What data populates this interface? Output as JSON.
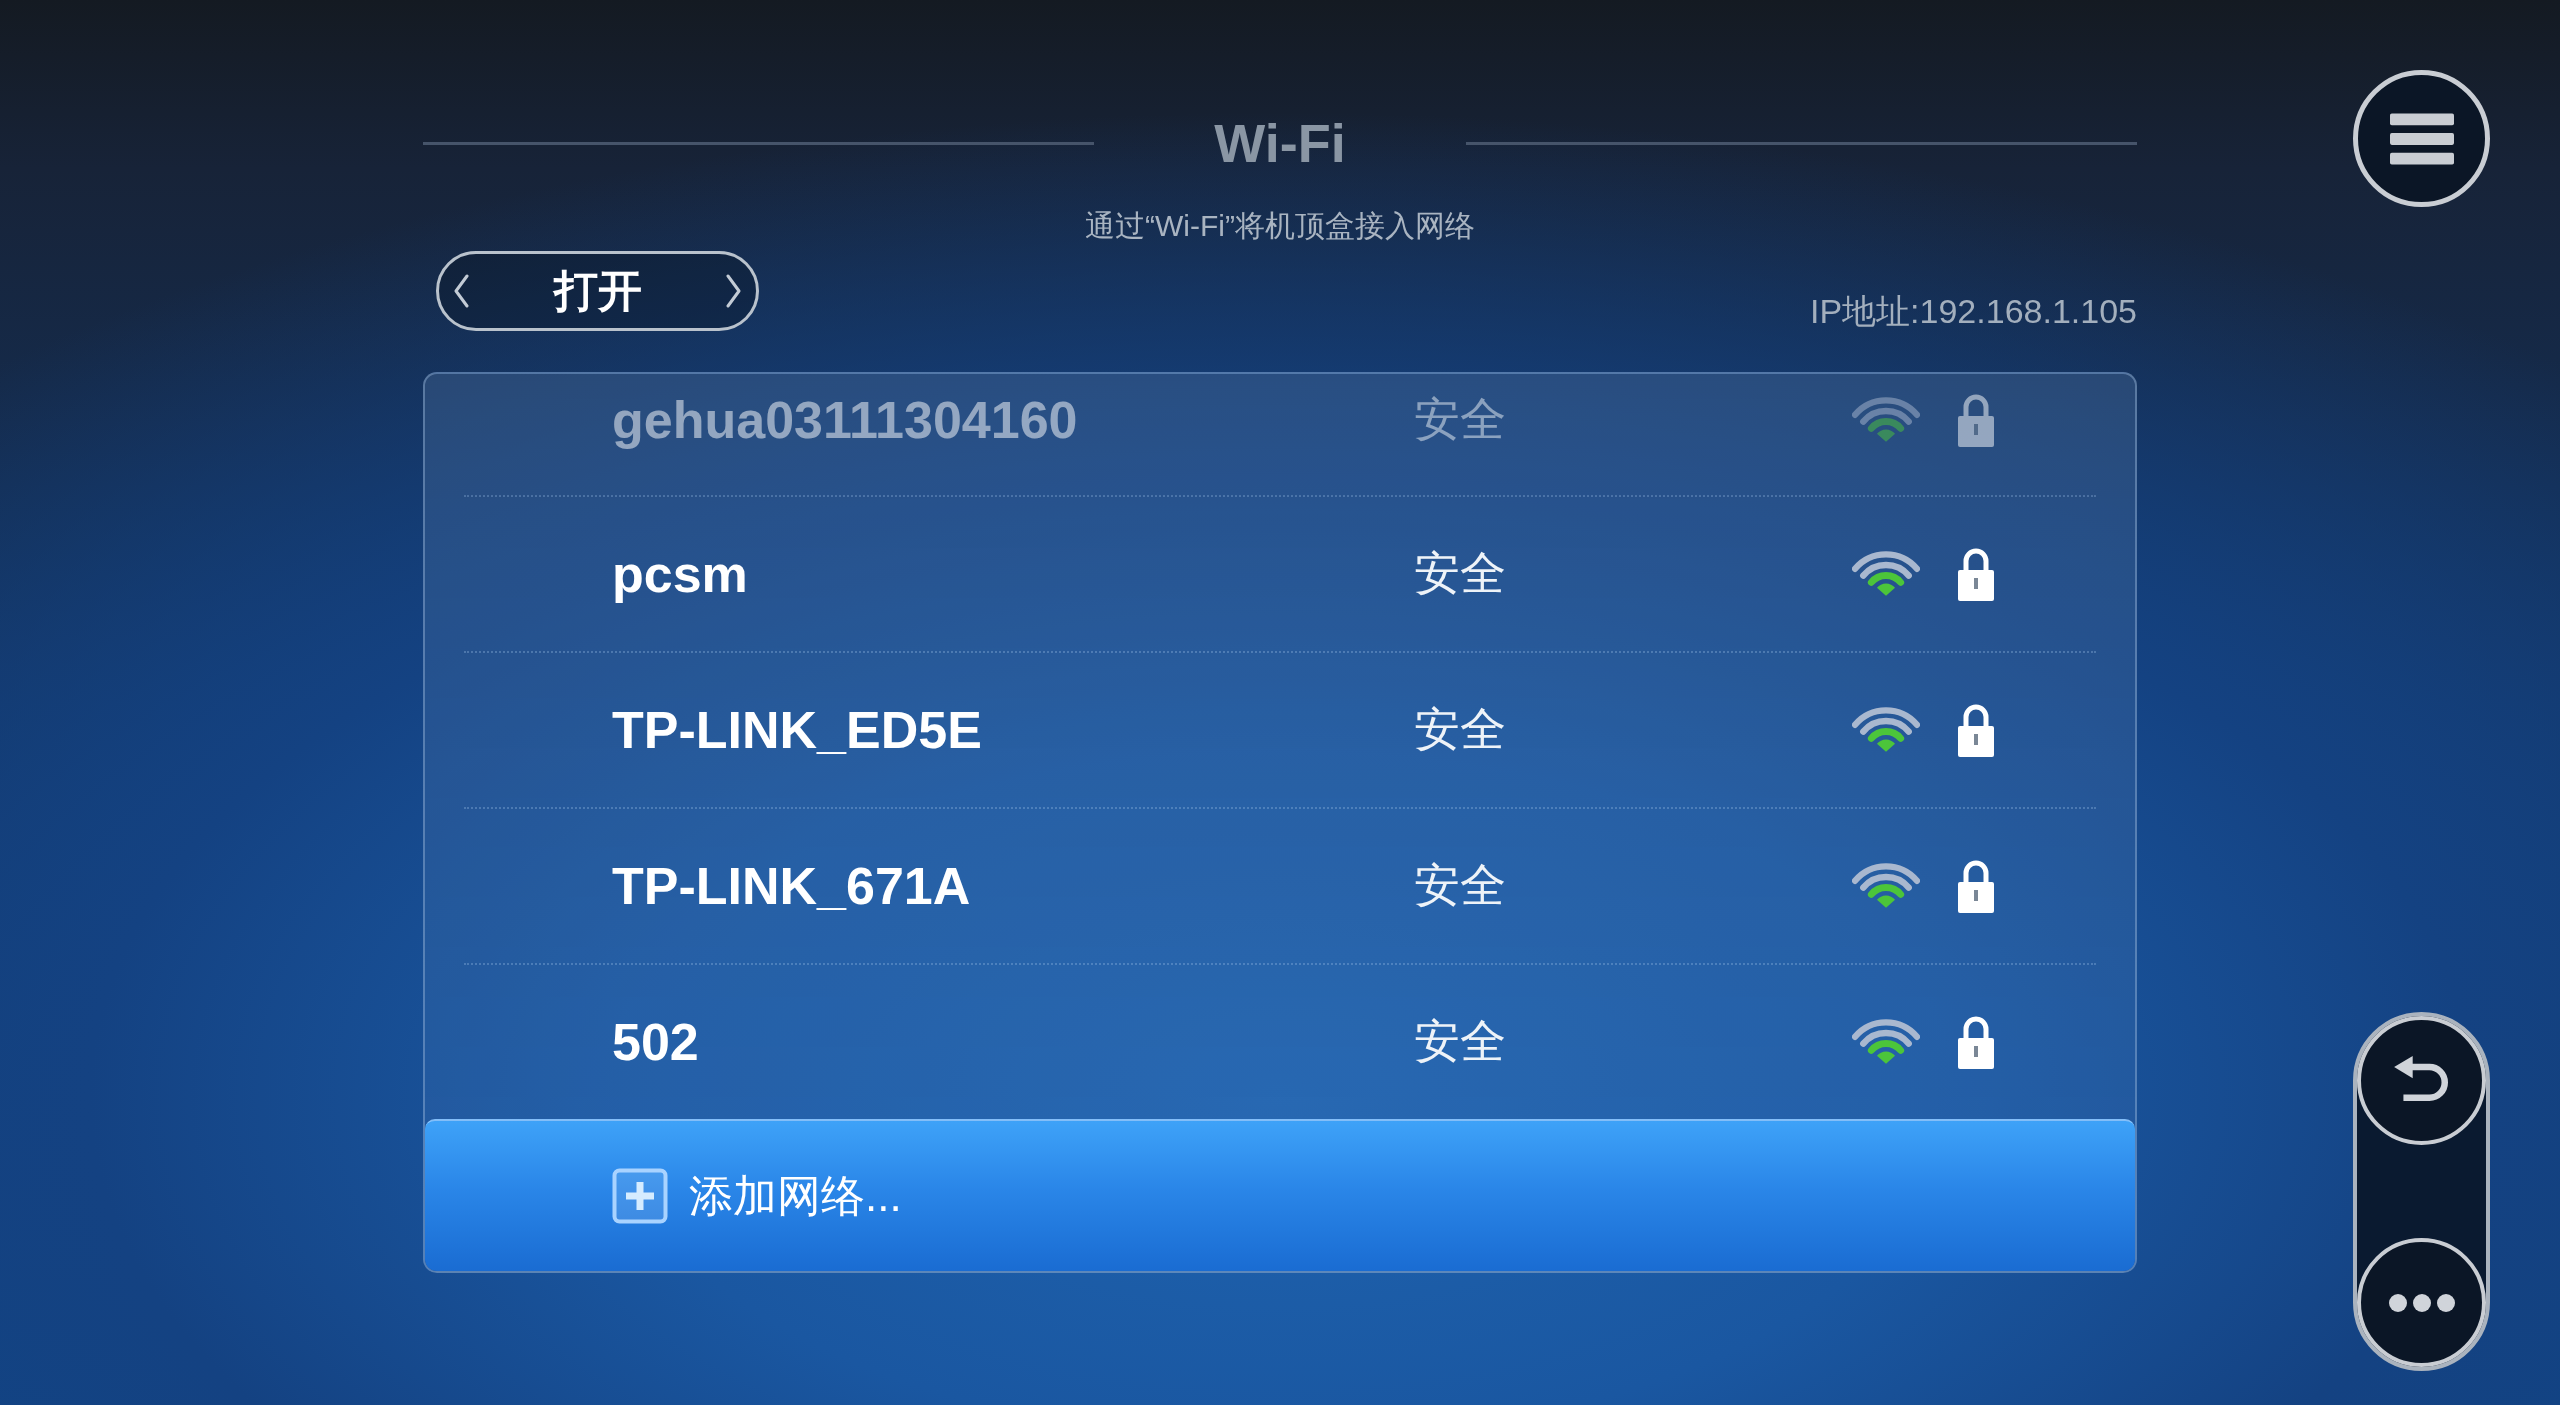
{
  "header": {
    "title": "Wi-Fi",
    "subtitle": "通过“Wi-Fi”将机顶盒接入网络"
  },
  "wifi_switch": {
    "value": "打开"
  },
  "ip_address": "IP地址:192.168.1.105",
  "networks": [
    {
      "name": "gehua03111304160",
      "security": "安全"
    },
    {
      "name": "pcsm",
      "security": "安全"
    },
    {
      "name": "TP-LINK_ED5E",
      "security": "安全"
    },
    {
      "name": "TP-LINK_671A",
      "security": "安全"
    },
    {
      "name": "502",
      "security": "安全"
    }
  ],
  "add_network": {
    "label": "添加网络..."
  }
}
